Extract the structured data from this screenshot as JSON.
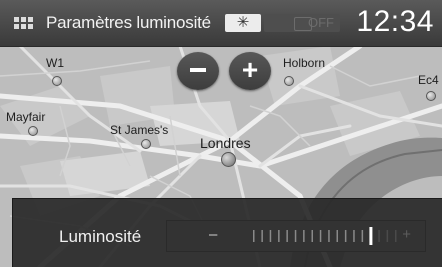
{
  "header": {
    "title": "Paramètres luminosité",
    "mode_icon": "sun-icon",
    "toggle_label": "OFF",
    "clock": "12:34"
  },
  "map": {
    "labels": {
      "w1": "W1",
      "holborn": "Holborn",
      "ec4": "Ec4",
      "mayfair": "Mayfair",
      "st_james": "St James's",
      "londres": "Londres"
    }
  },
  "zoom": {
    "minus_icon": "minus-icon",
    "plus_label": "+"
  },
  "brightness": {
    "label": "Luminosité",
    "minus_label": "–",
    "plus_label": "+",
    "level": 0.82
  }
}
